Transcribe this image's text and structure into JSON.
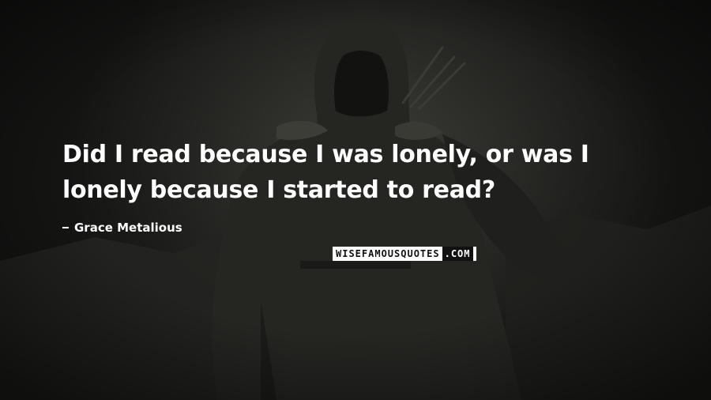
{
  "quote": {
    "line1": "Did I read because I was lonely, or was I",
    "line2": "lonely because I started to read?"
  },
  "author": {
    "name": "Grace Metalious"
  },
  "watermark": {
    "text": "WISEFAMOUSQUOTES",
    "suffix": ".COM"
  }
}
